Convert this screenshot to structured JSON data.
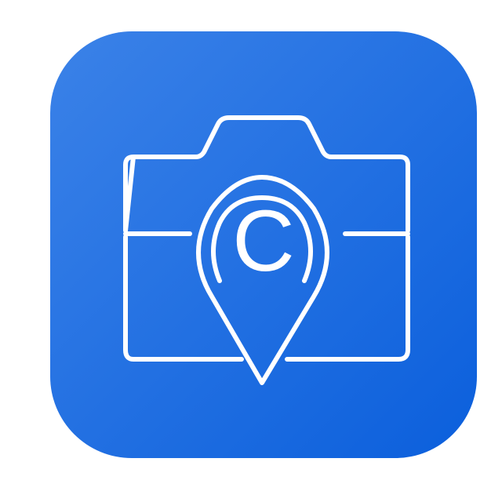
{
  "app_icon": {
    "name": "camera-location-app",
    "colors": {
      "tile_start": "#3b82e8",
      "tile_end": "#0b5fdc",
      "tile_edge": "#1a6ee0",
      "glyph": "#ffffff",
      "background": "#ffffff"
    },
    "icons": {
      "camera": "camera-icon",
      "pin": "map-pin-icon"
    },
    "pin_letter": "C"
  }
}
